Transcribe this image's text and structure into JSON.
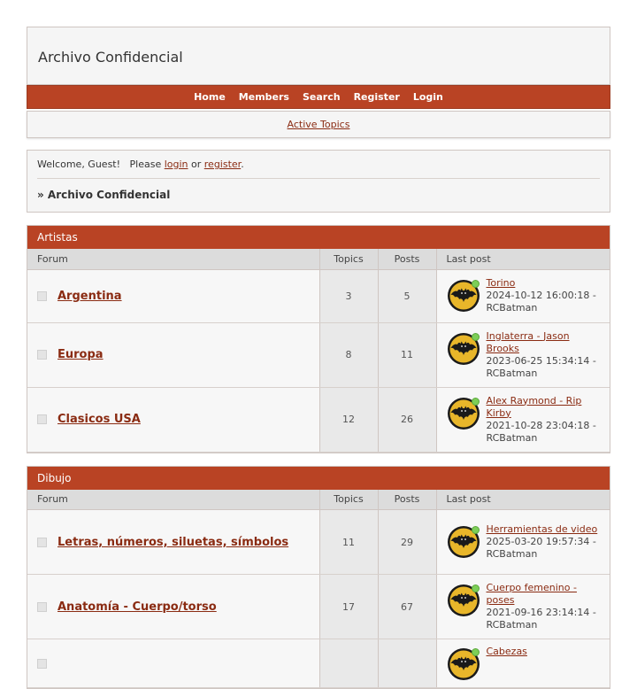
{
  "site": {
    "title": "Archivo Confidencial"
  },
  "nav": [
    "Home",
    "Members",
    "Search",
    "Register",
    "Login"
  ],
  "subnav": {
    "active_topics": "Active Topics"
  },
  "welcome": {
    "prefix": "Welcome, Guest!   Please ",
    "login": "login",
    "or": " or ",
    "register": "register",
    "suffix": ".",
    "breadcrumb": "» Archivo Confidencial"
  },
  "columns": {
    "forum": "Forum",
    "topics": "Topics",
    "posts": "Posts",
    "last_post": "Last post"
  },
  "categories": [
    {
      "name": "Artistas",
      "forums": [
        {
          "name": "Argentina",
          "topics": "3",
          "posts": "5",
          "last_title": "Torino",
          "last_date": "2024-10-12 16:00:18 -",
          "last_user": "RCBatman"
        },
        {
          "name": "Europa",
          "topics": "8",
          "posts": "11",
          "last_title": "Inglaterra - Jason Brooks",
          "last_date": "2023-06-25 15:34:14 -",
          "last_user": "RCBatman"
        },
        {
          "name": "Clasicos USA",
          "topics": "12",
          "posts": "26",
          "last_title": "Alex Raymond - Rip Kirby",
          "last_date": "2021-10-28 23:04:18 -",
          "last_user": "RCBatman"
        }
      ]
    },
    {
      "name": "Dibujo",
      "forums": [
        {
          "name": "Letras, números, siluetas, símbolos",
          "topics": "11",
          "posts": "29",
          "last_title": "Herramientas de video",
          "last_date": "2025-03-20 19:57:34 -",
          "last_user": "RCBatman"
        },
        {
          "name": "Anatomía - Cuerpo/torso",
          "topics": "17",
          "posts": "67",
          "last_title": "Cuerpo femenino - poses",
          "last_date": "2021-09-16 23:14:14 -",
          "last_user": "RCBatman"
        },
        {
          "name": "",
          "topics": "",
          "posts": "",
          "last_title": "Cabezas",
          "last_date": "",
          "last_user": ""
        }
      ]
    }
  ],
  "colors": {
    "accent": "#b94324",
    "link": "#8a2b12",
    "online": "#7dce58"
  },
  "icons": {
    "forum_status": "forum-read-icon",
    "avatar": "batman-logo-avatar",
    "online": "online-status-dot"
  }
}
